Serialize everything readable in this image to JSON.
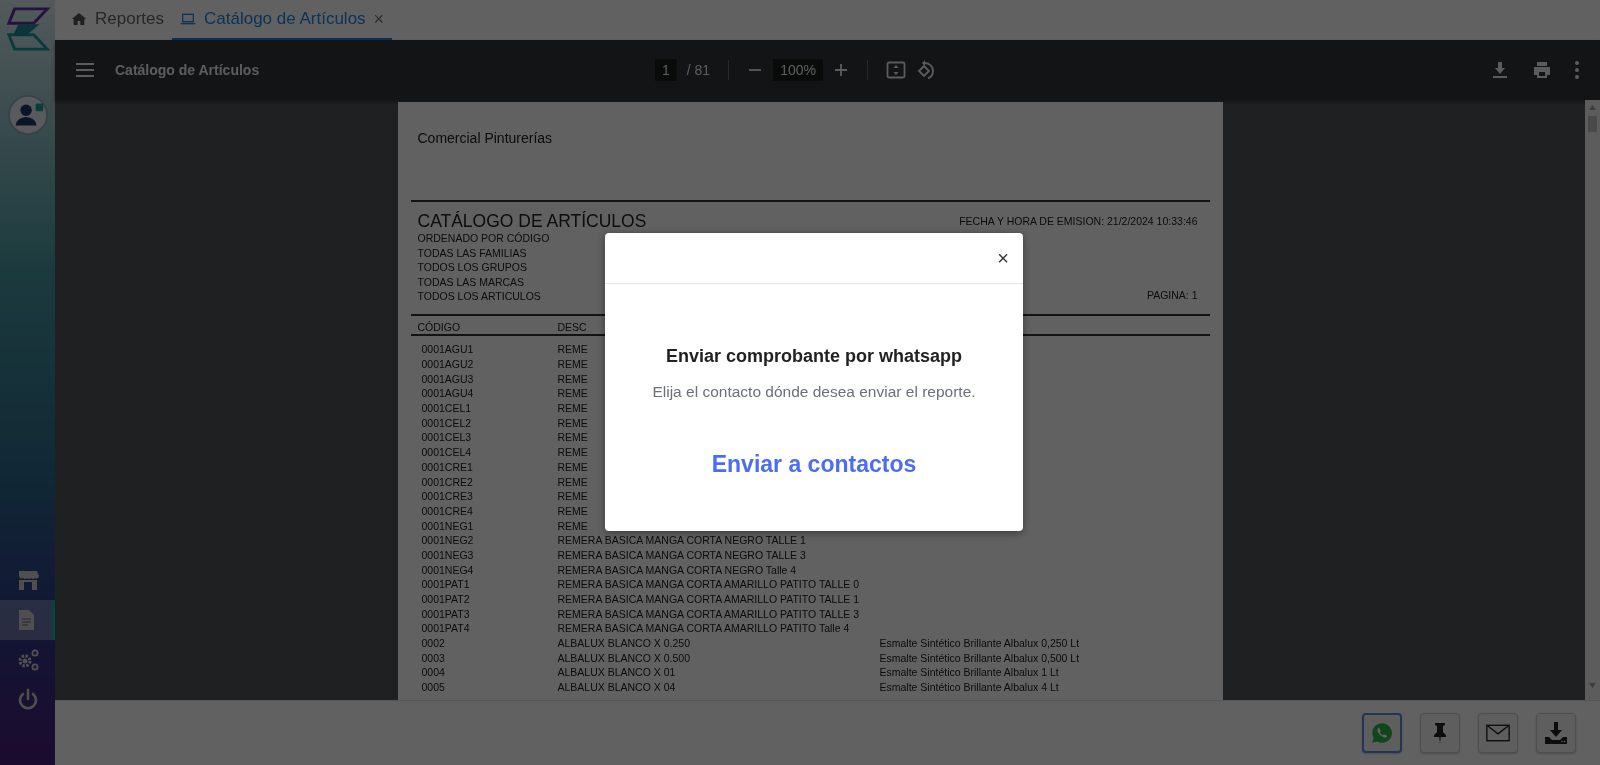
{
  "sidebar": {
    "items": [
      {
        "kind": "store",
        "selected": false
      },
      {
        "kind": "document",
        "selected": true
      },
      {
        "kind": "settings",
        "selected": false
      },
      {
        "kind": "power",
        "selected": false
      }
    ]
  },
  "tabs": [
    {
      "kind": "home",
      "label": "Reportes",
      "selected": false
    },
    {
      "kind": "laptop",
      "label": "Catálogo de Artículos",
      "selected": true,
      "close": "×"
    }
  ],
  "viewer": {
    "title": "Catálogo de Artículos",
    "page": "1",
    "page_count": "/ 81",
    "zoom": "100%"
  },
  "report": {
    "company": "Comercial Pinturerías",
    "title": "CATÁLOGO DE ARTÍCULOS",
    "emission": "FECHA Y HORA DE EMISION: 21/2/2024 10:33:46",
    "filters": [
      "ORDENADO POR CÓDIGO",
      "TODAS LAS FAMILIAS",
      "TODOS LOS GRUPOS",
      "TODAS LAS MARCAS",
      "TODOS LOS ARTICULOS"
    ],
    "page_label": "PAGINA: 1",
    "columns": [
      "CÓDIGO",
      "DESC"
    ],
    "rows": [
      {
        "code": "0001AGU1",
        "description": "REME"
      },
      {
        "code": "0001AGU2",
        "description": "REME"
      },
      {
        "code": "0001AGU3",
        "description": "REME"
      },
      {
        "code": "0001AGU4",
        "description": "REME"
      },
      {
        "code": "0001CEL1",
        "description": "REME"
      },
      {
        "code": "0001CEL2",
        "description": "REME"
      },
      {
        "code": "0001CEL3",
        "description": "REME"
      },
      {
        "code": "0001CEL4",
        "description": "REME"
      },
      {
        "code": "0001CRE1",
        "description": "REME"
      },
      {
        "code": "0001CRE2",
        "description": "REME"
      },
      {
        "code": "0001CRE3",
        "description": "REME"
      },
      {
        "code": "0001CRE4",
        "description": "REME"
      },
      {
        "code": "0001NEG1",
        "description": "REME"
      },
      {
        "code": "0001NEG2",
        "description": "REMERA BASICA MANGA CORTA NEGRO TALLE 1"
      },
      {
        "code": "0001NEG3",
        "description": "REMERA BASICA MANGA CORTA NEGRO TALLE 3"
      },
      {
        "code": "0001NEG4",
        "description": "REMERA BASICA MANGA CORTA NEGRO Talle 4"
      },
      {
        "code": "0001PAT1",
        "description": "REMERA BASICA MANGA CORTA AMARILLO PATITO TALLE 0"
      },
      {
        "code": "0001PAT2",
        "description": "REMERA BASICA MANGA CORTA AMARILLO PATITO TALLE 1"
      },
      {
        "code": "0001PAT3",
        "description": "REMERA BASICA MANGA CORTA AMARILLO PATITO TALLE 3"
      },
      {
        "code": "0001PAT4",
        "description": "REMERA BASICA MANGA CORTA AMARILLO PATITO Talle 4"
      },
      {
        "code": "0002",
        "description": "ALBALUX BLANCO X 0.250",
        "detail": "Esmalte Sintético Brillante Albalux 0,250 Lt"
      },
      {
        "code": "0003",
        "description": "ALBALUX BLANCO X 0.500",
        "detail": "Esmalte Sintético Brillante Albalux 0,500 Lt"
      },
      {
        "code": "0004",
        "description": "ALBALUX BLANCO X 01",
        "detail": "Esmalte Sintético Brillante Albalux 1 Lt"
      },
      {
        "code": "0005",
        "description": "ALBALUX BLANCO X 04",
        "detail": "Esmalte Sintético Brillante Albalux 4 Lt"
      }
    ]
  },
  "actions": [
    {
      "kind": "whatsapp",
      "selected": true
    },
    {
      "kind": "pin",
      "selected": false
    },
    {
      "kind": "mail",
      "selected": false
    },
    {
      "kind": "download",
      "selected": false
    }
  ],
  "modal": {
    "close": "×",
    "title": "Enviar comprobante por whatsapp",
    "message": "Elija el contacto dónde desea enviar el reporte.",
    "action": "Enviar a contactos"
  }
}
